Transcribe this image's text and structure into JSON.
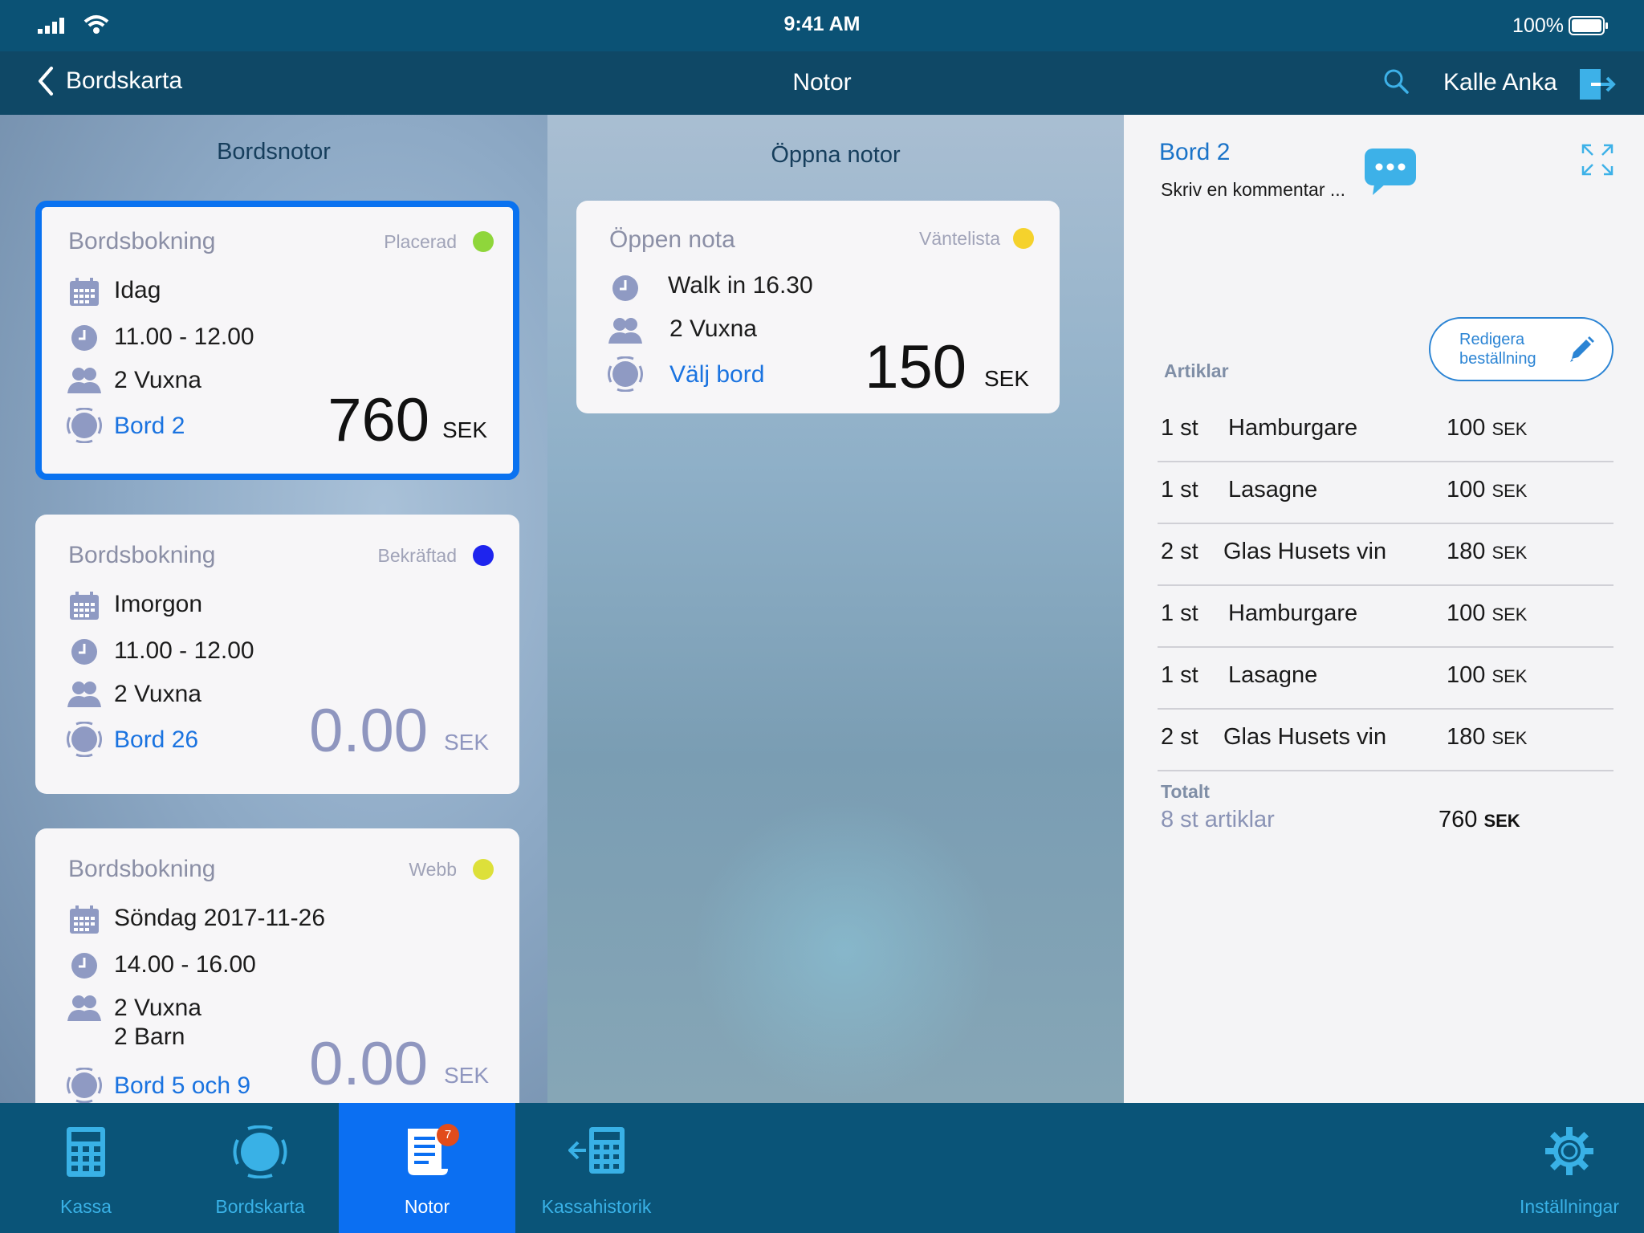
{
  "status_bar": {
    "time": "9:41 AM",
    "battery": "100%"
  },
  "nav": {
    "back_label": "Bordskarta",
    "title": "Notor",
    "user": "Kalle Anka"
  },
  "left_panel": {
    "heading": "Bordsnotor",
    "cards": [
      {
        "type": "Bordsbokning",
        "status": "Placerad",
        "status_color": "#8fd63b",
        "date": "Idag",
        "time": "11.00 - 12.00",
        "guests": "2 Vuxna",
        "guests2": "",
        "table": "Bord 2",
        "amount": "760",
        "currency": "SEK"
      },
      {
        "type": "Bordsbokning",
        "status": "Bekräftad",
        "status_color": "#1e24ee",
        "date": "Imorgon",
        "time": "11.00 - 12.00",
        "guests": "2 Vuxna",
        "guests2": "",
        "table": "Bord 26",
        "amount": "0.00",
        "currency": "SEK"
      },
      {
        "type": "Bordsbokning",
        "status": "Webb",
        "status_color": "#dde03a",
        "date": "Söndag 2017-11-26",
        "time": "14.00 - 16.00",
        "guests": "2 Vuxna",
        "guests2": "2 Barn",
        "table": "Bord 5 och 9",
        "amount": "0.00",
        "currency": "SEK"
      }
    ]
  },
  "mid_panel": {
    "heading": "Öppna notor",
    "card": {
      "type": "Öppen nota",
      "status": "Väntelista",
      "status_color": "#f5d22c",
      "time": "Walk in 16.30",
      "guests": "2 Vuxna",
      "table": "Välj bord",
      "amount": "150",
      "currency": "SEK"
    }
  },
  "right_panel": {
    "title": "Bord 2",
    "comment_placeholder": "Skriv en kommentar ...",
    "edit_button": "Redigera beställning",
    "items_label": "Artiklar",
    "items": [
      {
        "qty": "1 st",
        "name": "Hamburgare",
        "price": "100",
        "currency": "SEK"
      },
      {
        "qty": "1 st",
        "name": "Lasagne",
        "price": "100",
        "currency": "SEK"
      },
      {
        "qty": "2 st",
        "name": "Glas Husets vin",
        "price": "180",
        "currency": "SEK"
      },
      {
        "qty": "1 st",
        "name": "Hamburgare",
        "price": "100",
        "currency": "SEK"
      },
      {
        "qty": "1 st",
        "name": "Lasagne",
        "price": "100",
        "currency": "SEK"
      },
      {
        "qty": "2 st",
        "name": "Glas Husets vin",
        "price": "180",
        "currency": "SEK"
      }
    ],
    "total_label": "Totalt",
    "total_count": "8 st  artiklar",
    "total_sum": "760",
    "total_currency": "SEK"
  },
  "tabs": [
    {
      "label": "Kassa",
      "icon": "calculator-icon"
    },
    {
      "label": "Bordskarta",
      "icon": "table-map-icon"
    },
    {
      "label": "Notor",
      "icon": "receipt-icon",
      "badge": "7"
    },
    {
      "label": "Kassahistorik",
      "icon": "history-icon"
    },
    {
      "label": "Inställningar",
      "icon": "gear-icon"
    }
  ]
}
